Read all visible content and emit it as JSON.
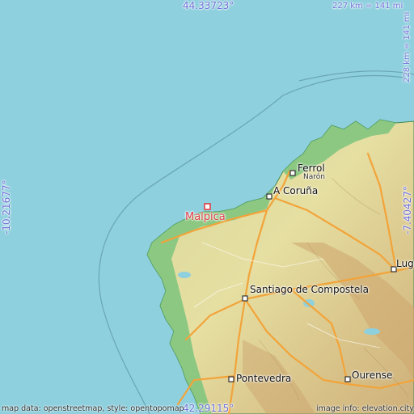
{
  "map": {
    "highlight_town": "Malpica",
    "towns": {
      "ferrol": "Ferrol",
      "naron": "Narón",
      "a_coruna": "A Coruña",
      "santiago": "Santiago de Compostela",
      "lugo": "Lugo",
      "pontevedra": "Pontevedra",
      "ourense": "Ourense"
    },
    "coordinates": {
      "top": "44.33723°",
      "bottom": "42.29115°",
      "left": "-10.21677°",
      "right": "-7.40427°"
    },
    "scale": {
      "horizontal": "227 km = 141 mi",
      "vertical": "228 km = 141 mi"
    },
    "credits": {
      "left": "map data: openstreetmap, style: opentopomap",
      "right": "image info: elevation.city"
    },
    "colors": {
      "sea": "#8fd0de",
      "land_low": "#7cc47c",
      "land_mid": "#e6dfa2",
      "land_high": "#cfb07a",
      "highway": "#f2a43a",
      "highlight": "#e0404a",
      "coord_text": "#6f72d8"
    }
  }
}
